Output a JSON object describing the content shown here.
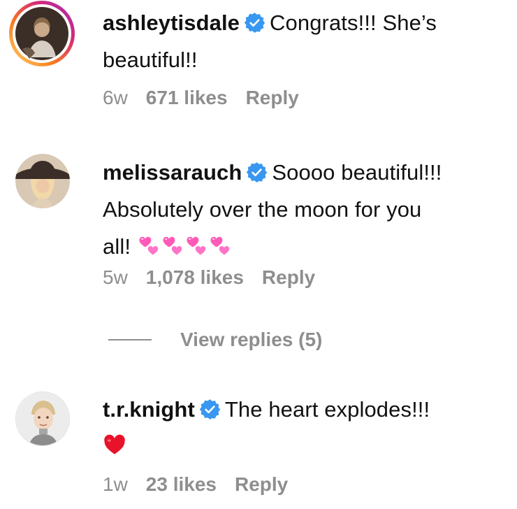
{
  "comments": [
    {
      "username": "ashleytisdale",
      "text_line1": "Congrats!!! She’s",
      "text_line2": "beautiful!!",
      "time": "6w",
      "likes": "671 likes",
      "reply": "Reply",
      "avatar": "ashley-avatar",
      "verified": true
    },
    {
      "username": "melissarauch",
      "text_line1": "Soooo beautiful!!!",
      "text_line2": "Absolutely over the moon for you",
      "text_line3": "all!",
      "emojis": [
        "two-hearts-icon",
        "two-hearts-icon",
        "two-hearts-icon",
        "two-hearts-icon"
      ],
      "time": "5w",
      "likes": "1,078 likes",
      "reply": "Reply",
      "avatar": "melissa-avatar",
      "verified": true
    },
    {
      "username": "t.r.knight",
      "text_line1": "The heart explodes!!!",
      "emojis": [
        "red-heart-icon"
      ],
      "time": "1w",
      "likes": "23 likes",
      "reply": "Reply",
      "avatar": "trknight-avatar",
      "verified": true
    }
  ],
  "view_replies": "View replies (5)",
  "colors": {
    "text": "#111111",
    "meta": "#8e8e8e",
    "verified_blue": "#3897f0",
    "story_ring": [
      "#feda75",
      "#fa7e1e",
      "#d62976",
      "#962fbf"
    ]
  }
}
